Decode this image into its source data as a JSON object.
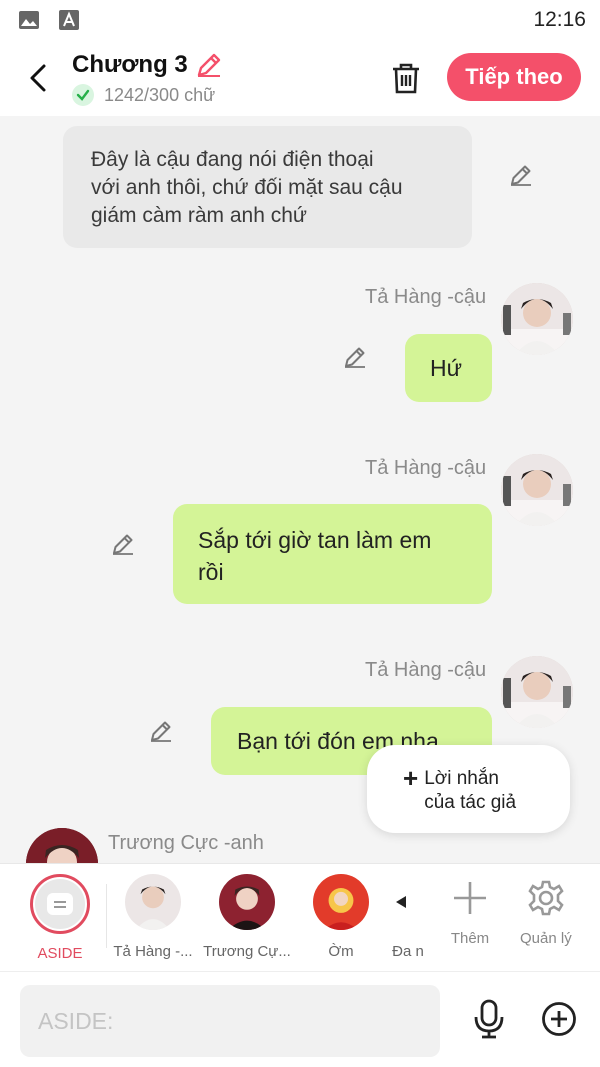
{
  "status_bar": {
    "time": "12:16",
    "icons": [
      "image-icon",
      "font-a-icon"
    ]
  },
  "header": {
    "title": "Chương 3",
    "word_count": "1242/300 chữ",
    "next_button": "Tiếp theo",
    "icons": [
      "back-arrow-icon",
      "pencil-icon",
      "check-icon",
      "trash-icon"
    ]
  },
  "messages": [
    {
      "type": "narration",
      "text_lines": [
        "Đây là cậu đang nói điện thoại",
        "với anh thôi, chứ đối mặt sau cậu",
        "giám càm ràm anh chứ"
      ]
    },
    {
      "type": "character",
      "speaker": "Tả Hàng -cậu",
      "text_lines": [
        "Hứ"
      ]
    },
    {
      "type": "character",
      "speaker": "Tả Hàng -cậu",
      "text_lines": [
        "Sắp tới giờ tan làm em",
        "rồi"
      ]
    },
    {
      "type": "character",
      "speaker": "Tả Hàng -cậu",
      "text_lines": [
        "Bạn tới đón em nha"
      ]
    },
    {
      "type": "character",
      "speaker": "Trương Cực -anh",
      "text_lines": []
    }
  ],
  "author_note": {
    "plus": "+",
    "lines": [
      "Lời nhắn",
      "của tác giả"
    ]
  },
  "characters": [
    {
      "label": "ASIDE",
      "selected": true
    },
    {
      "label": "Tả Hàng -..."
    },
    {
      "label": "Trương Cự..."
    },
    {
      "label": "Ờm"
    },
    {
      "label": "Đa n"
    }
  ],
  "tools": {
    "add_label": "Thêm",
    "manage_label": "Quản lý"
  },
  "input": {
    "placeholder": "ASIDE:"
  },
  "colors": {
    "accent": "#f4506a",
    "bubble_green": "#d4f497",
    "bubble_gray": "#e9e9e9",
    "selected_ring": "#e14b5f"
  }
}
